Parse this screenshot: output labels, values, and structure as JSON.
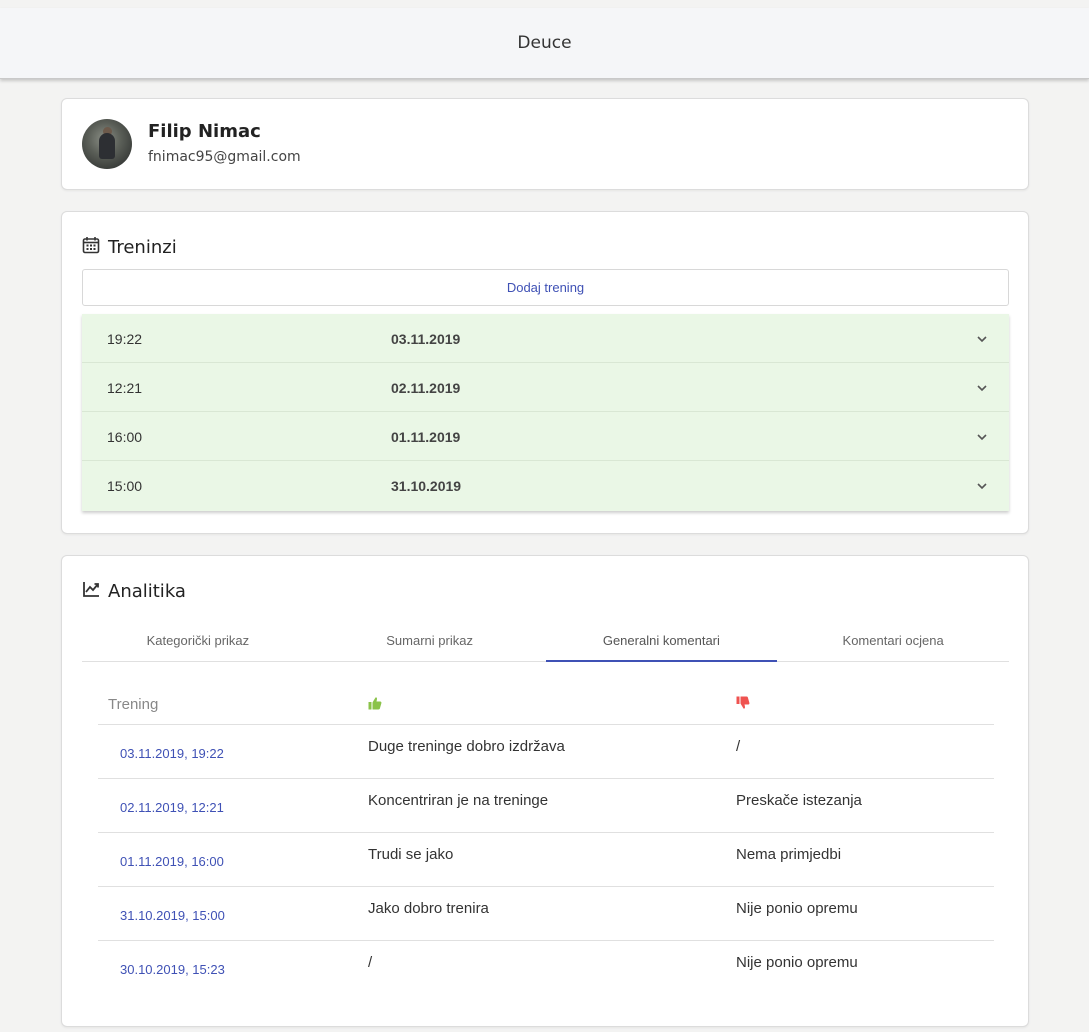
{
  "app": {
    "title": "Deuce"
  },
  "profile": {
    "name": "Filip Nimac",
    "email": "fnimac95@gmail.com"
  },
  "trainings": {
    "heading": "Treninzi",
    "icon": "calendar-icon",
    "add_label": "Dodaj trening",
    "items": [
      {
        "time": "19:22",
        "date": "03.11.2019"
      },
      {
        "time": "12:21",
        "date": "02.11.2019"
      },
      {
        "time": "16:00",
        "date": "01.11.2019"
      },
      {
        "time": "15:00",
        "date": "31.10.2019"
      }
    ]
  },
  "analytics": {
    "heading": "Analitika",
    "icon": "line-chart-icon",
    "tabs": [
      {
        "label": "Kategorički prikaz"
      },
      {
        "label": "Sumarni prikaz"
      },
      {
        "label": "Generalni komentari"
      },
      {
        "label": "Komentari ocjena"
      }
    ],
    "active_tab": "Generalni komentari",
    "table": {
      "col_training": "Trening",
      "col_positive_icon": "thumbs-up-icon",
      "col_negative_icon": "thumbs-down-icon",
      "rows": [
        {
          "training": "03.11.2019, 19:22",
          "positive": "Duge treninge dobro izdržava",
          "negative": "/"
        },
        {
          "training": "02.11.2019, 12:21",
          "positive": "Koncentriran je na treninge",
          "negative": "Preskače istezanja"
        },
        {
          "training": "01.11.2019, 16:00",
          "positive": "Trudi se jako",
          "negative": "Nema primjedbi"
        },
        {
          "training": "31.10.2019, 15:00",
          "positive": "Jako dobro trenira",
          "negative": "Nije ponio opremu"
        },
        {
          "training": "30.10.2019, 15:23",
          "positive": "/",
          "negative": "Nije ponio opremu"
        }
      ]
    }
  },
  "colors": {
    "accent": "#3f51b5",
    "training_row_bg": "#eaf7e6",
    "thumbs_up": "#8bc34a",
    "thumbs_down": "#ef5350"
  }
}
